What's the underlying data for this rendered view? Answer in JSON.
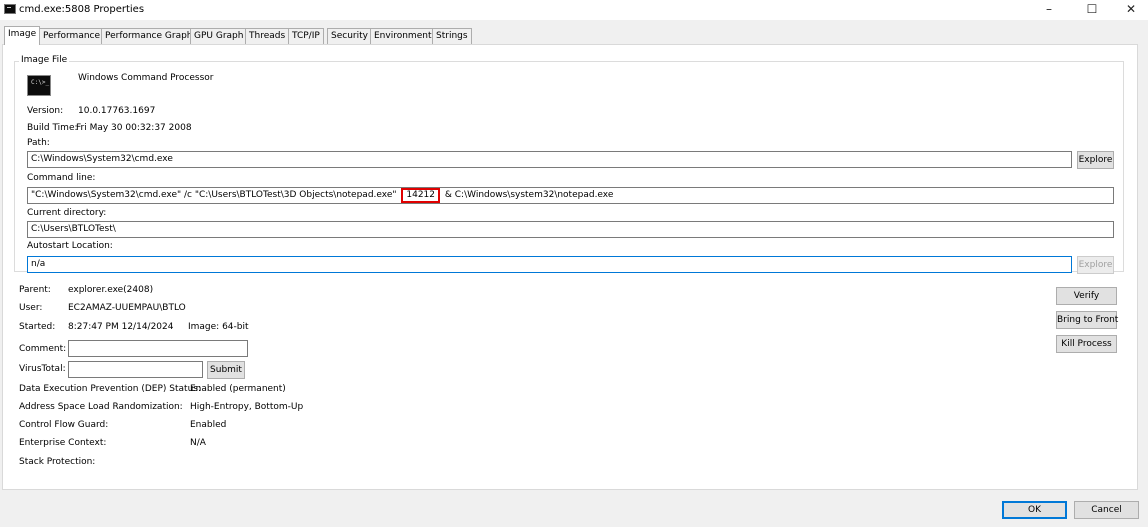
{
  "window": {
    "title": "cmd.exe:5808 Properties",
    "minimize": "–",
    "maximize": "☐",
    "close": "✕"
  },
  "tabs": [
    "Image",
    "Performance",
    "Performance Graph",
    "GPU Graph",
    "Threads",
    "TCP/IP",
    "Security",
    "Environment",
    "Strings"
  ],
  "image_file": {
    "group_label": "Image File",
    "description": "Windows Command Processor",
    "version_label": "Version:",
    "version": "10.0.17763.1697",
    "build_time_label": "Build Time:",
    "build_time": "Fri May 30 00:32:37 2008",
    "path_label": "Path:",
    "path": "C:\\Windows\\System32\\cmd.exe",
    "explore_label": "Explore",
    "command_line_label": "Command line:",
    "command_line_part1": "\"C:\\Windows\\System32\\cmd.exe\" /c \"C:\\Users\\BTLOTest\\3D Objects\\notepad.exe\"",
    "command_line_highlight": "14212",
    "command_line_part2": "& C:\\Windows\\system32\\notepad.exe",
    "current_dir_label": "Current directory:",
    "current_dir": "C:\\Users\\BTLOTest\\",
    "autostart_label": "Autostart Location:",
    "autostart": "n/a",
    "explore2_label": "Explore"
  },
  "process": {
    "parent_label": "Parent:",
    "parent": "explorer.exe(2408)",
    "user_label": "User:",
    "user": "EC2AMAZ-UUEMPAU\\BTLO",
    "started_label": "Started:",
    "started": "8:27:47 PM  12/14/2024",
    "image_label": "Image: 64-bit",
    "comment_label": "Comment:",
    "comment_value": "",
    "virustotal_label": "VirusTotal:",
    "virustotal_value": "",
    "submit_label": "Submit",
    "dep_label": "Data Execution Prevention (DEP) Status:",
    "dep": "Enabled (permanent)",
    "aslr_label": "Address Space Load Randomization:",
    "aslr": "High-Entropy, Bottom-Up",
    "cfg_label": "Control Flow Guard:",
    "cfg": "Enabled",
    "enterprise_label": "Enterprise Context:",
    "enterprise": "N/A",
    "stack_label": "Stack Protection:",
    "stack": ""
  },
  "actions": {
    "verify": "Verify",
    "bring_to_front": "Bring to Front",
    "kill_process": "Kill Process"
  },
  "footer": {
    "ok": "OK",
    "cancel": "Cancel"
  },
  "colors": {
    "highlight": "#e00000",
    "focus_border": "#0078d7"
  }
}
